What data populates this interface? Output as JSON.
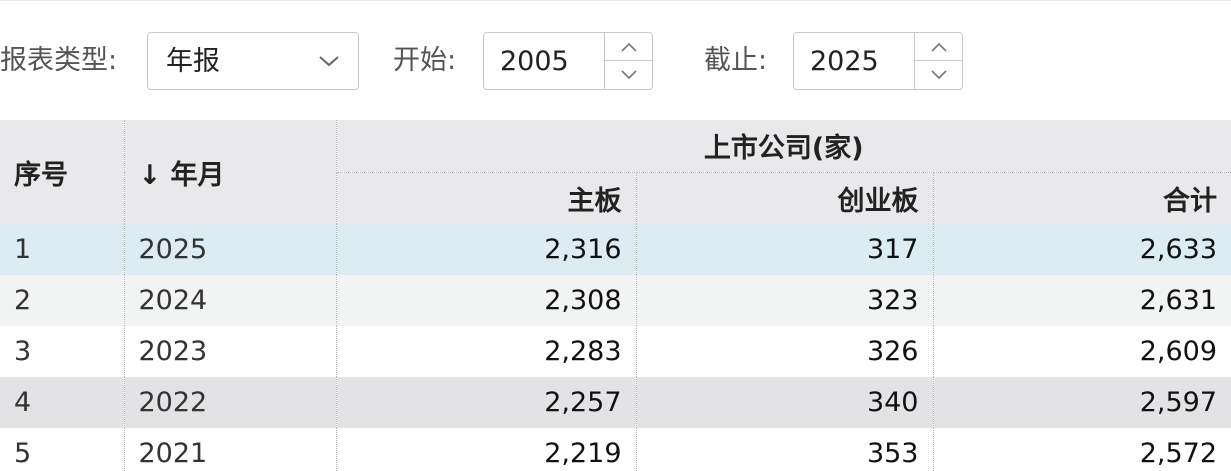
{
  "filters": {
    "report_type_label": "报表类型:",
    "report_type_value": "年报",
    "start_label": "开始:",
    "start_value": "2005",
    "end_label": "截止:",
    "end_value": "2025"
  },
  "table": {
    "headers": {
      "seq": "序号",
      "year": "↓ 年月",
      "group": "上市公司(家)",
      "main_board": "主板",
      "chinext": "创业板",
      "total": "合计"
    },
    "rows": [
      {
        "seq": "1",
        "year": "2025",
        "main_board": "2,316",
        "chinext": "317",
        "total": "2,633"
      },
      {
        "seq": "2",
        "year": "2024",
        "main_board": "2,308",
        "chinext": "323",
        "total": "2,631"
      },
      {
        "seq": "3",
        "year": "2023",
        "main_board": "2,283",
        "chinext": "326",
        "total": "2,609"
      },
      {
        "seq": "4",
        "year": "2022",
        "main_board": "2,257",
        "chinext": "340",
        "total": "2,597"
      },
      {
        "seq": "5",
        "year": "2021",
        "main_board": "2,219",
        "chinext": "353",
        "total": "2,572"
      }
    ]
  },
  "colors": {
    "selected_row": "#dcecf2",
    "header_bg": "#e9e9ec"
  }
}
